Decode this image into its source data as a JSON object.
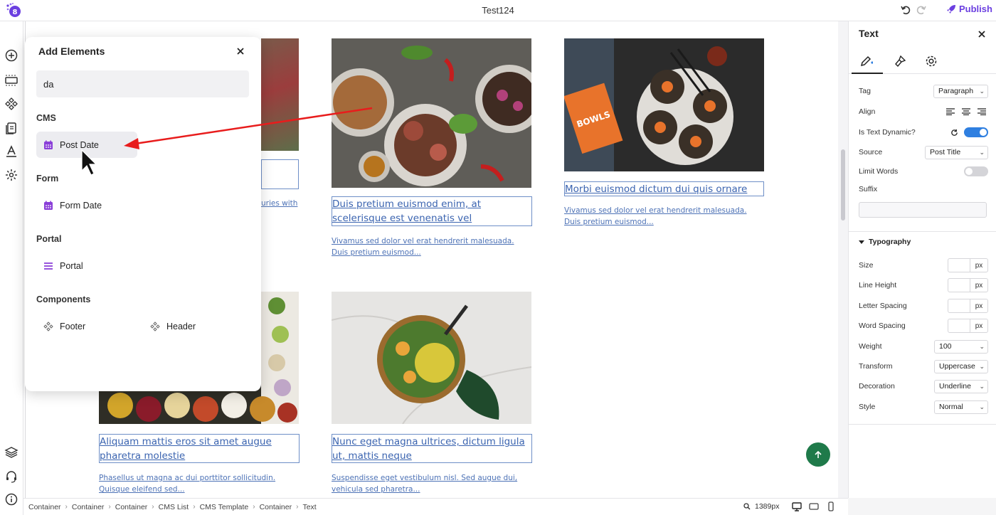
{
  "topbar": {
    "title": "Test124",
    "publish_label": "Publish"
  },
  "add_panel": {
    "title": "Add Elements",
    "search_value": "da",
    "sections": [
      {
        "label": "CMS",
        "items": [
          "Post Date"
        ]
      },
      {
        "label": "Form",
        "items": [
          "Form Date"
        ]
      },
      {
        "label": "Portal",
        "items": [
          "Portal"
        ]
      },
      {
        "label": "Components",
        "items": [
          "Footer",
          "Header"
        ]
      }
    ]
  },
  "cards": [
    {
      "title": "",
      "desc": "uries with"
    },
    {
      "title": "Duis pretium euismod enim, at scelerisque est venenatis vel",
      "desc": "Vivamus sed dolor vel erat hendrerit malesuada. Duis pretium euismod..."
    },
    {
      "title": "Morbi euismod dictum dui quis ornare",
      "desc": "Vivamus sed dolor vel erat hendrerit malesuada. Duis pretium euismod..."
    },
    {
      "title": "Aliquam mattis eros sit amet augue pharetra molestie",
      "desc": "Phasellus ut magna ac dui porttitor sollicitudin. Quisque eleifend sed..."
    },
    {
      "title": "Nunc eget magna ultrices, dictum ligula ut, mattis neque",
      "desc": "Suspendisse eget vestibulum nisl. Sed augue dui, vehicula sed pharetra..."
    }
  ],
  "bowl_text": "BOWLS",
  "props": {
    "title": "Text",
    "tag_label": "Tag",
    "tag_value": "Paragraph",
    "align_label": "Align",
    "dynamic_label": "Is Text Dynamic?",
    "source_label": "Source",
    "source_value": "Post Title",
    "limit_label": "Limit Words",
    "suffix_label": "Suffix",
    "typography_label": "Typography",
    "size_label": "Size",
    "line_height_label": "Line Height",
    "letter_spacing_label": "Letter Spacing",
    "word_spacing_label": "Word Spacing",
    "unit": "px",
    "weight_label": "Weight",
    "weight_value": "100",
    "transform_label": "Transform",
    "transform_value": "Uppercase",
    "decoration_label": "Decoration",
    "decoration_value": "Underline",
    "style_label": "Style",
    "style_value": "Normal",
    "dynamic_on": true,
    "limit_on": false
  },
  "breadcrumb": [
    "Container",
    "Container",
    "Container",
    "CMS List",
    "CMS Template",
    "Container",
    "Text"
  ],
  "zoom_value": "1389px",
  "colors": {
    "accent": "#6b3fe0",
    "link": "#3b64b0",
    "toggle_on": "#2f7fe0",
    "scroll_top": "#1f7a4a",
    "annotation_arrow": "#e81c1c"
  }
}
